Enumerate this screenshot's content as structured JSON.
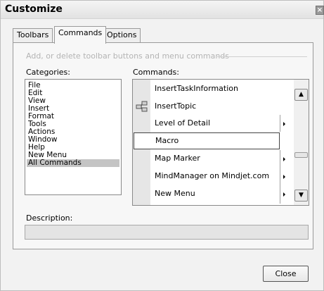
{
  "window": {
    "title": "Customize",
    "close_glyph": "×"
  },
  "tabs": [
    {
      "label": "Toolbars"
    },
    {
      "label": "Commands"
    },
    {
      "label": "Options"
    }
  ],
  "active_tab": "Commands",
  "hint": "Add, or delete toolbar buttons and menu commands",
  "categories": {
    "label": "Categories:",
    "items": [
      "File",
      "Edit",
      "View",
      "Insert",
      "Format",
      "Tools",
      "Actions",
      "Window",
      "Help",
      "New Menu",
      "All Commands"
    ],
    "selected": "All Commands"
  },
  "commands": {
    "label": "Commands:",
    "items": [
      {
        "label": "InsertTaskInformation",
        "icon": "none",
        "submenu": false
      },
      {
        "label": "InsertTopic",
        "icon": "insert-topic-icon",
        "submenu": false
      },
      {
        "label": "Level of Detail",
        "icon": "none",
        "submenu": true
      },
      {
        "label": "Macro",
        "icon": "none",
        "submenu": false
      },
      {
        "label": "Map Marker",
        "icon": "none",
        "submenu": true
      },
      {
        "label": "MindManager on Mindjet.com",
        "icon": "none",
        "submenu": true
      },
      {
        "label": "New Menu",
        "icon": "none",
        "submenu": true
      }
    ],
    "selected": "Macro",
    "scroll_up_glyph": "▲",
    "scroll_down_glyph": "▼"
  },
  "description": {
    "label": "Description:",
    "value": ""
  },
  "buttons": {
    "close": "Close"
  },
  "colors": {
    "selection": "#c4c4c4",
    "window_bg": "#f2f2f2",
    "panel_bg": "#f7f7f7"
  }
}
